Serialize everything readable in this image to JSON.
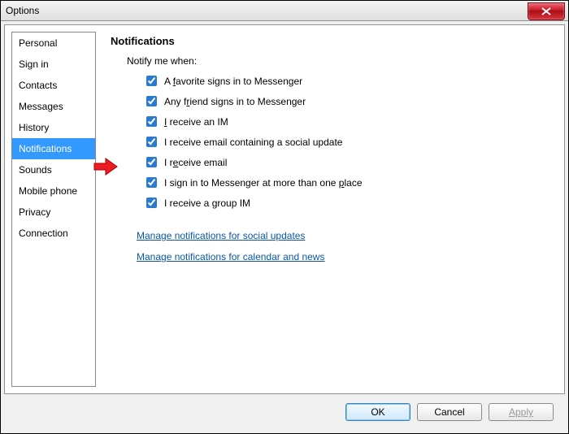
{
  "window": {
    "title": "Options"
  },
  "sidebar": {
    "items": [
      {
        "label": "Personal",
        "selected": false
      },
      {
        "label": "Sign in",
        "selected": false
      },
      {
        "label": "Contacts",
        "selected": false
      },
      {
        "label": "Messages",
        "selected": false
      },
      {
        "label": "History",
        "selected": false
      },
      {
        "label": "Notifications",
        "selected": true
      },
      {
        "label": "Sounds",
        "selected": false
      },
      {
        "label": "Mobile phone",
        "selected": false
      },
      {
        "label": "Privacy",
        "selected": false
      },
      {
        "label": "Connection",
        "selected": false
      }
    ]
  },
  "content": {
    "heading": "Notifications",
    "intro": "Notify me when:",
    "checks": [
      {
        "label": "A favorite signs in to Messenger",
        "u": "f",
        "checked": true,
        "highlighted": false
      },
      {
        "label": "Any friend signs in to Messenger",
        "u": "r",
        "checked": true,
        "highlighted": false
      },
      {
        "label": "I receive an IM",
        "u": "I",
        "checked": true,
        "highlighted": false
      },
      {
        "label": "I receive email containing a social update",
        "u": "",
        "checked": true,
        "highlighted": false
      },
      {
        "label": "I receive email",
        "u": "e",
        "checked": true,
        "highlighted": true
      },
      {
        "label": "I sign in to Messenger at more than one place",
        "u": "p",
        "checked": true,
        "highlighted": false
      },
      {
        "label": "I receive a group IM",
        "u": "",
        "checked": true,
        "highlighted": false
      }
    ],
    "links": [
      {
        "label": "Manage notifications for social updates"
      },
      {
        "label": "Manage notifications for calendar and news"
      }
    ]
  },
  "buttons": {
    "ok": "OK",
    "cancel": "Cancel",
    "apply": "Apply"
  }
}
